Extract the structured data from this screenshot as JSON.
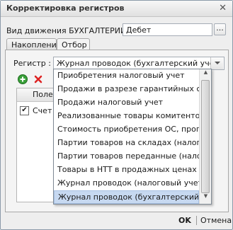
{
  "window": {
    "title": "Корректировка регистров",
    "close_glyph": "✕"
  },
  "movement": {
    "label": "Вид движения БУХГАЛТЕРИИ:",
    "value": "Дебет",
    "dots": "..."
  },
  "tabs": [
    {
      "label": "Накопления",
      "active": false
    },
    {
      "label": "Отбор",
      "active": true
    }
  ],
  "register": {
    "label": "Регистр :",
    "value": "Журнал проводок (бухгалтерский учет)"
  },
  "toolbar": {
    "add_icon": "plus-circle-icon",
    "delete_icon": "red-x-icon"
  },
  "grid": {
    "column": "Поле",
    "rows": [
      {
        "checked": true,
        "check_glyph": "✔",
        "value": "Счет"
      }
    ]
  },
  "dropdown_items": [
    "Приобретения налоговый учет",
    "Продажи в разрезе гарантийных сроко...",
    "Продажи налоговый учет",
    "Реализованные товары комитентов",
    "Стоимость приобретения ОС, пропорци...",
    "Партии товаров на складах (налоговы...",
    "Партии товаров переданные (налоговы...",
    "Товары в НТТ в продажных ценах (нал...",
    "Журнал проводок (налоговый учет)",
    "Журнал проводок (бухгалтерский учет)"
  ],
  "selected_index": 9,
  "footer": {
    "ok": "OK",
    "cancel": "Отмена"
  }
}
